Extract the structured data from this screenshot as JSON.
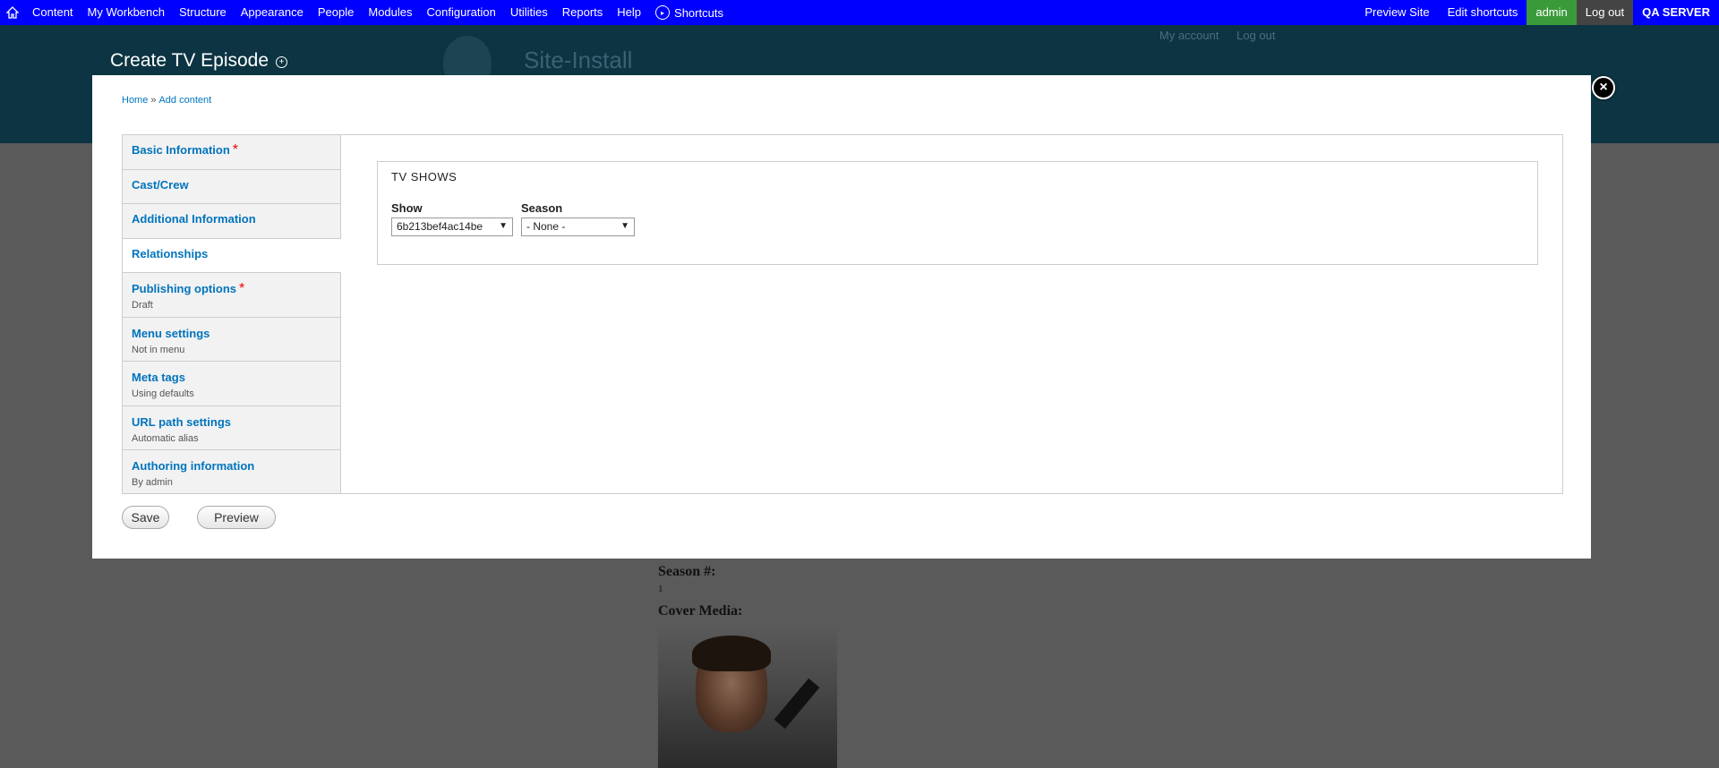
{
  "toolbar": {
    "home_icon": "home-icon",
    "menu": [
      "Content",
      "My Workbench",
      "Structure",
      "Appearance",
      "People",
      "Modules",
      "Configuration",
      "Utilities",
      "Reports",
      "Help"
    ],
    "shortcuts_label": "Shortcuts",
    "shortcuts_icon": "chevron-right-circle-icon",
    "right": {
      "preview_site": "Preview Site",
      "edit_shortcuts": "Edit shortcuts",
      "user": "admin",
      "log_out": "Log out",
      "server": "QA SERVER"
    },
    "colors": {
      "background": "#0000ff",
      "user_badge": "#3a9a3a"
    }
  },
  "background_page": {
    "page_title": "Create TV Episode",
    "site_name": "Site-Install",
    "secondary_links": [
      "My account",
      "Log out"
    ],
    "content": {
      "season_label": "Season #:",
      "season_value": "1",
      "cover_label": "Cover Media:"
    }
  },
  "modal": {
    "breadcrumb": {
      "home": "Home",
      "separator": "»",
      "current": "Add content"
    },
    "close_icon": "close-icon",
    "tabs": [
      {
        "title": "Basic Information",
        "required": "*",
        "summary": ""
      },
      {
        "title": "Cast/Crew",
        "required": "",
        "summary": ""
      },
      {
        "title": "Additional Information",
        "required": "",
        "summary": ""
      },
      {
        "title": "Relationships",
        "required": "",
        "summary": "",
        "active": true
      },
      {
        "title": "Publishing options",
        "required": "*",
        "summary": "Draft"
      },
      {
        "title": "Menu settings",
        "required": "",
        "summary": "Not in menu"
      },
      {
        "title": "Meta tags",
        "required": "",
        "summary": "Using defaults"
      },
      {
        "title": "URL path settings",
        "required": "",
        "summary": "Automatic alias"
      },
      {
        "title": "Authoring information",
        "required": "",
        "summary": "By admin"
      }
    ],
    "fieldset": {
      "legend": "TV SHOWS",
      "show": {
        "label": "Show",
        "value": "6b213bef4ac14be"
      },
      "season": {
        "label": "Season",
        "value": "- None -"
      }
    },
    "buttons": {
      "save": "Save",
      "preview": "Preview"
    }
  }
}
